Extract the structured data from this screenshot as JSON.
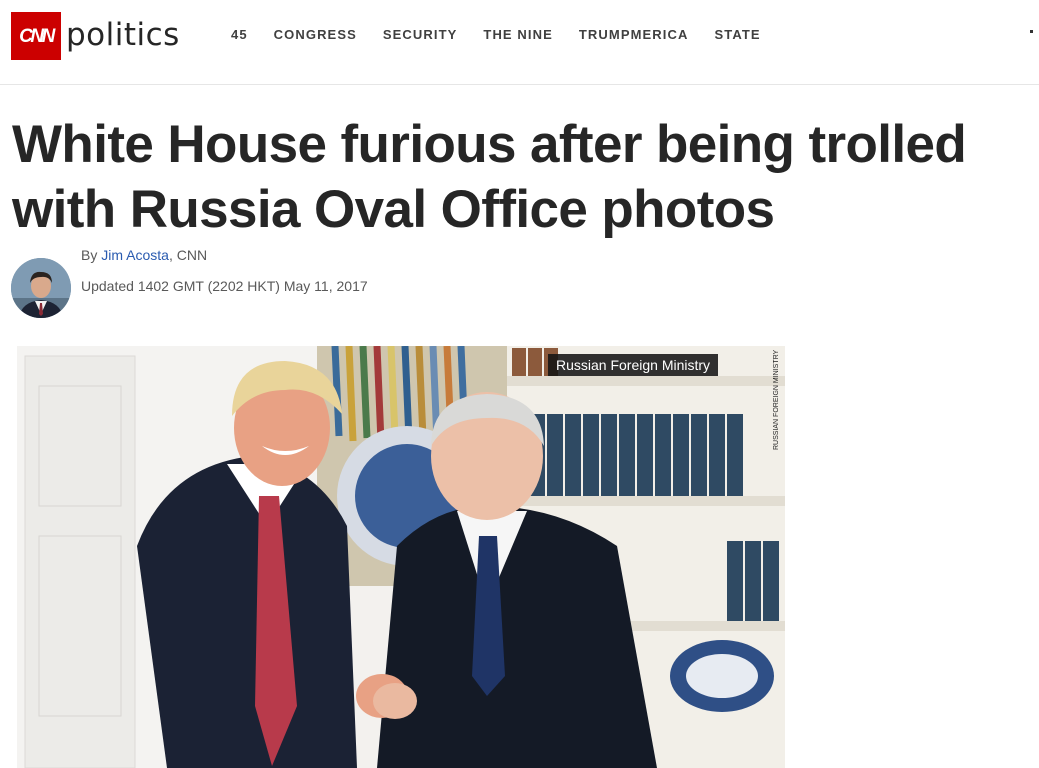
{
  "header": {
    "logo_text": "CNN",
    "section_name": "politics",
    "nav_items": [
      "45",
      "CONGRESS",
      "SECURITY",
      "THE NINE",
      "TRUMPMERICA",
      "STATE"
    ],
    "brand_color": "#cc0000"
  },
  "article": {
    "headline": "White House furious after being trolled with Russia Oval Office photos",
    "byline_prefix": "By ",
    "author": "Jim Acosta",
    "byline_suffix": ", CNN",
    "timestamp": "Updated 1402 GMT (2202 HKT) May 11, 2017",
    "author_link_color": "#2a5bb0"
  },
  "photo": {
    "caption": "Russian Foreign Ministry",
    "credit": "RUSSIAN FOREIGN MINISTRY"
  }
}
